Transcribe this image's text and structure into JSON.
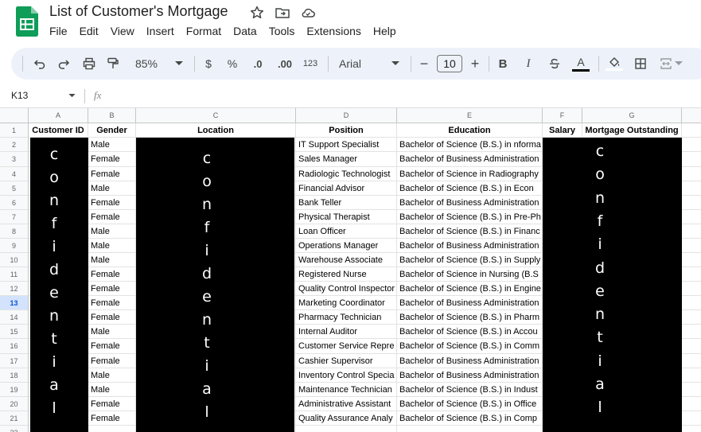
{
  "app": {
    "title": "List of Customer's Mortgage",
    "menu": [
      "File",
      "Edit",
      "View",
      "Insert",
      "Format",
      "Data",
      "Tools",
      "Extensions",
      "Help"
    ]
  },
  "toolbar": {
    "zoom": "85%",
    "currency": "$",
    "percent": "%",
    "decrease_decimal": ".0",
    "increase_decimal": ".00",
    "number_format": "123",
    "font": "Arial",
    "font_size": "10",
    "bold": "B",
    "italic": "I",
    "text_color": "A"
  },
  "formula_bar": {
    "cell_ref": "K13",
    "fx": "fx"
  },
  "sheet": {
    "columns": [
      "A",
      "B",
      "C",
      "D",
      "E",
      "F",
      "G"
    ],
    "headers": [
      "Customer ID",
      "Gender",
      "Location",
      "Position",
      "Education",
      "Salary",
      "Mortgage Outstanding"
    ],
    "row_numbers": [
      "1",
      "2",
      "3",
      "4",
      "5",
      "6",
      "7",
      "8",
      "9",
      "10",
      "11",
      "12",
      "13",
      "14",
      "15",
      "16",
      "17",
      "18",
      "19",
      "20",
      "21",
      "22"
    ],
    "selected_row": "13",
    "redaction_text": "confidential",
    "rows": [
      {
        "gender": "Male",
        "position": "IT Support Specialist",
        "education": "Bachelor of Science (B.S.) in nforma"
      },
      {
        "gender": "Female",
        "position": "Sales Manager",
        "education": "Bachelor of Business Administration"
      },
      {
        "gender": "Female",
        "position": "Radiologic Technologist",
        "education": "Bachelor of Science in Radiography"
      },
      {
        "gender": "Male",
        "position": "Financial Advisor",
        "education": "Bachelor of Science (B.S.) in  Econ"
      },
      {
        "gender": "Female",
        "position": "Bank Teller",
        "education": "Bachelor of Business Administration"
      },
      {
        "gender": "Female",
        "position": "Physical Therapist",
        "education": "Bachelor of Science (B.S.) in Pre-Ph"
      },
      {
        "gender": "Male",
        "position": "Loan Officer",
        "education": "Bachelor of Science (B.S.) in Financ"
      },
      {
        "gender": "Male",
        "position": "Operations Manager",
        "education": "Bachelor of Business Administration"
      },
      {
        "gender": "Male",
        "position": "Warehouse Associate",
        "education": "Bachelor of Science (B.S.) in Supply"
      },
      {
        "gender": "Female",
        "position": "Registered Nurse",
        "education": "Bachelor of Science in Nursing (B.S"
      },
      {
        "gender": "Female",
        "position": "Quality Control Inspector",
        "education": "Bachelor of Science (B.S.) in Engine"
      },
      {
        "gender": "Female",
        "position": "Marketing Coordinator",
        "education": "Bachelor of Business Administration"
      },
      {
        "gender": "Female",
        "position": "Pharmacy Technician",
        "education": "Bachelor of Science (B.S.) in Pharm"
      },
      {
        "gender": "Male",
        "position": "Internal Auditor",
        "education": "Bachelor of Science (B.S.) in Accou"
      },
      {
        "gender": "Female",
        "position": "Customer Service Repre",
        "education": "Bachelor of Science (B.S.) in Comm"
      },
      {
        "gender": "Female",
        "position": "Cashier Supervisor",
        "education": "Bachelor of Business Administration"
      },
      {
        "gender": "Male",
        "position": "Inventory Control Specia",
        "education": "Bachelor of Business Administration"
      },
      {
        "gender": "Male",
        "position": "Maintenance Technician",
        "education": "Bachelor of Science (B.S.) in Indust"
      },
      {
        "gender": "Female",
        "position": "Administrative Assistant",
        "education": "Bachelor of Science (B.S.) in Office"
      },
      {
        "gender": "Female",
        "position": "Quality Assurance Analy",
        "education": "Bachelor of Science (B.S.) in Comp"
      }
    ]
  },
  "colors": {
    "toolbar_bg": "#edf2fa",
    "sheets_green": "#0f9d58",
    "header_bg": "#f8f9fa",
    "selected_row_bg": "#d3e3fd"
  }
}
